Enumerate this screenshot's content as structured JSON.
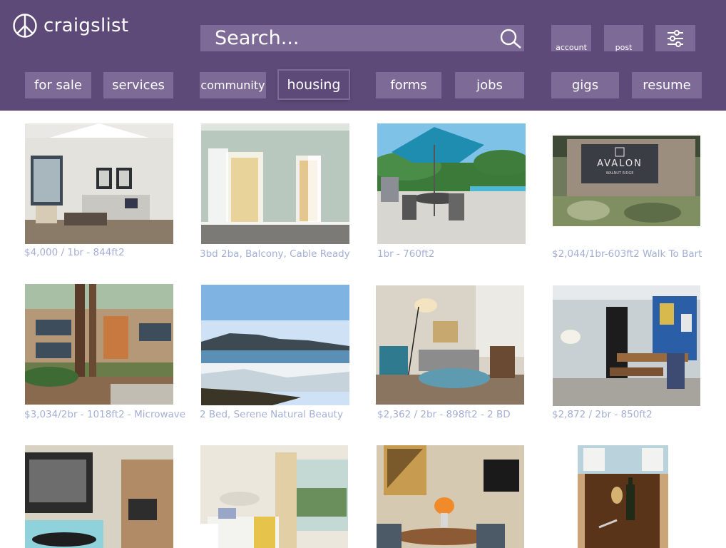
{
  "brand": {
    "name": "craigslist"
  },
  "search": {
    "placeholder": "Search..."
  },
  "account_label": "account",
  "post_label": "post",
  "nav": {
    "for_sale": "for sale",
    "services": "services",
    "community": "community",
    "housing": "housing",
    "forms": "forms",
    "jobs": "jobs",
    "gigs": "gigs",
    "resume": "resume"
  },
  "listings": [
    {
      "caption": "$4,000 / 1br - 844ft2"
    },
    {
      "caption": "3bd 2ba, Balcony, Cable Ready"
    },
    {
      "caption": "1br - 760ft2"
    },
    {
      "caption": "$2,044/1br-603ft2 Walk To Bart"
    },
    {
      "caption": "$3,034/2br - 1018ft2 - Microwave"
    },
    {
      "caption": "2 Bed, Serene Natural Beauty"
    },
    {
      "caption": "$2,362 / 2br - 898ft2 - 2 BD"
    },
    {
      "caption": "$2,872 / 2br - 850ft2"
    },
    {
      "caption": ""
    },
    {
      "caption": ""
    },
    {
      "caption": ""
    },
    {
      "caption": ""
    }
  ],
  "sign_text": {
    "line1": "AVALON",
    "line2": "WALNUT RIDGE"
  },
  "colors": {
    "header": "#5e4a78",
    "button": "#7d6a96",
    "caption": "#a4afd6"
  }
}
